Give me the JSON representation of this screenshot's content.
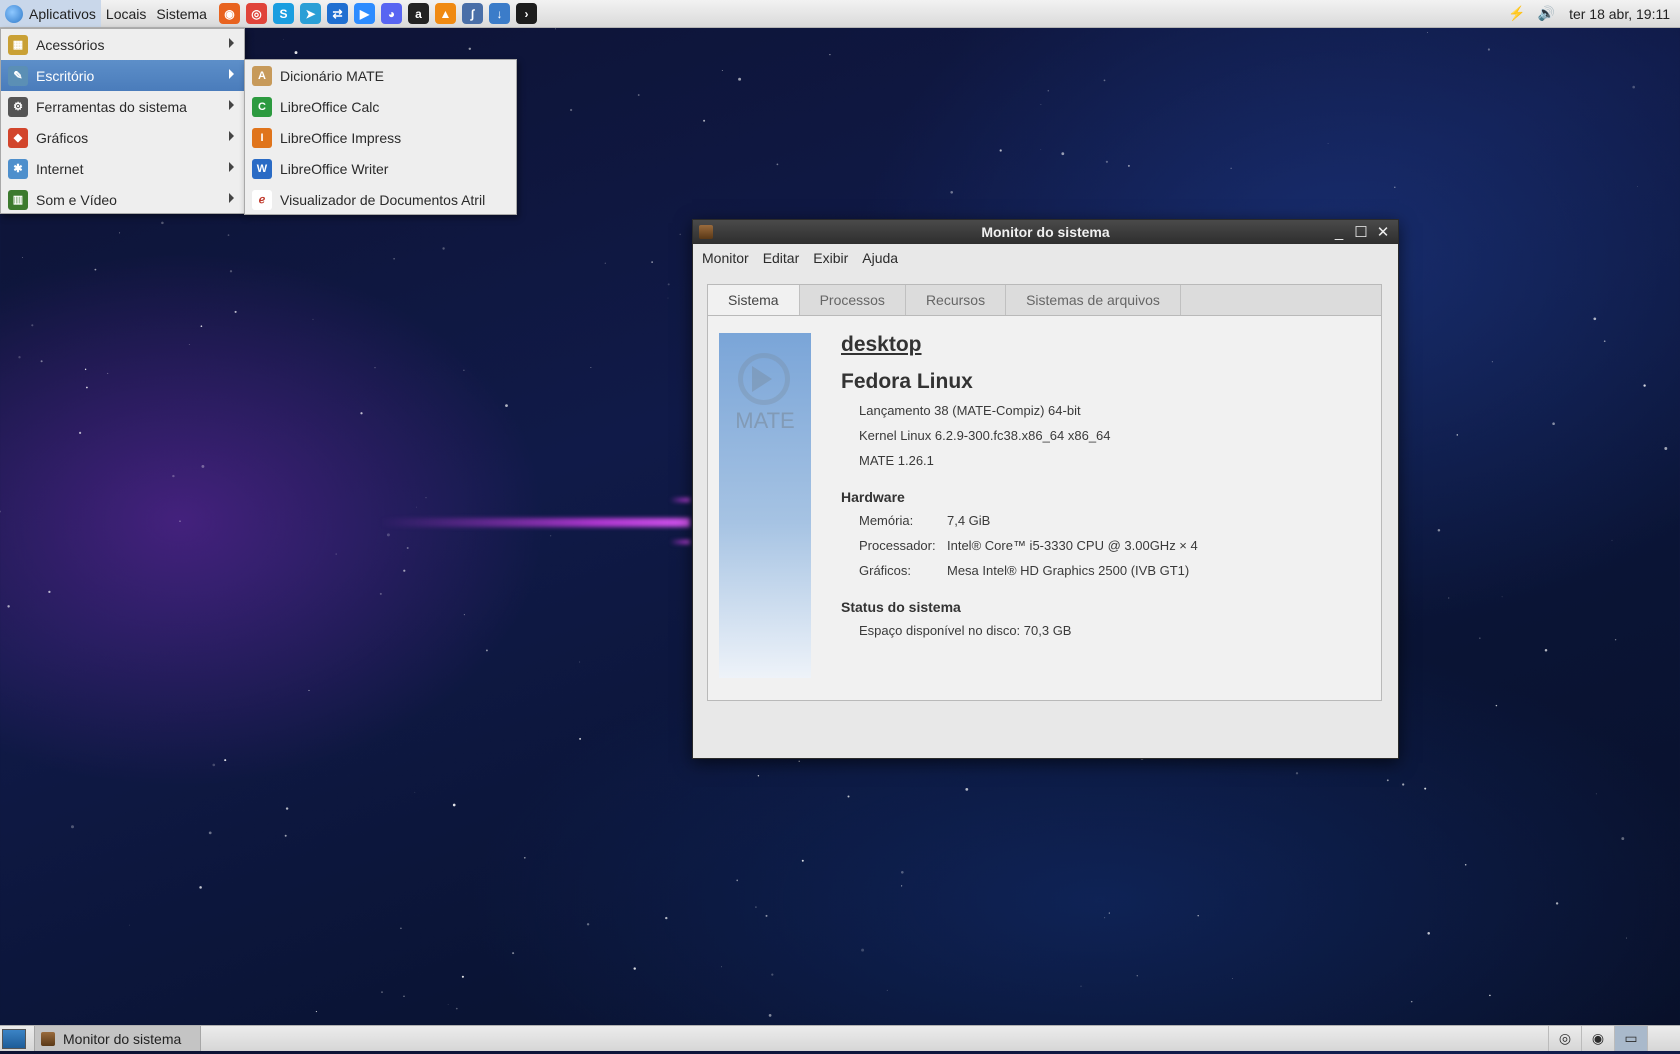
{
  "top_panel": {
    "menus": [
      {
        "label": "Aplicativos"
      },
      {
        "label": "Locais"
      },
      {
        "label": "Sistema"
      }
    ],
    "launchers": [
      {
        "icon": "firefox-icon",
        "color": "#e8631f",
        "glyph": "◉"
      },
      {
        "icon": "chrome-icon",
        "color": "#e0443a",
        "glyph": "◎"
      },
      {
        "icon": "skype-icon",
        "color": "#1a9ee0",
        "glyph": "S"
      },
      {
        "icon": "telegram-icon",
        "color": "#2a9fd6",
        "glyph": "➤"
      },
      {
        "icon": "teamviewer-icon",
        "color": "#1f6fd1",
        "glyph": "⇄"
      },
      {
        "icon": "zoom-icon",
        "color": "#2d8cff",
        "glyph": "▶"
      },
      {
        "icon": "discord-icon",
        "color": "#5865f2",
        "glyph": "◕"
      },
      {
        "icon": "amazon-icon",
        "color": "#222222",
        "glyph": "a"
      },
      {
        "icon": "vlc-icon",
        "color": "#f08a12",
        "glyph": "▲"
      },
      {
        "icon": "ebook-icon",
        "color": "#4a6fa8",
        "glyph": "∫"
      },
      {
        "icon": "download-icon",
        "color": "#3b7cc9",
        "glyph": "↓"
      },
      {
        "icon": "terminal-icon",
        "color": "#1c1c1c",
        "glyph": "›"
      }
    ],
    "tray": [
      {
        "icon": "network-icon",
        "glyph": "⚡"
      },
      {
        "icon": "volume-icon",
        "glyph": "🔊"
      }
    ],
    "clock": "ter 18 abr, 19:11"
  },
  "apps_menu": [
    {
      "label": "Acessórios",
      "icon": "accessories-icon",
      "color": "#c9a035",
      "glyph": "▦"
    },
    {
      "label": "Escritório",
      "icon": "office-icon",
      "color": "#5b8fb5",
      "glyph": "✎",
      "selected": true
    },
    {
      "label": "Ferramentas do sistema",
      "icon": "system-tools-icon",
      "color": "#555555",
      "glyph": "⚙"
    },
    {
      "label": "Gráficos",
      "icon": "graphics-icon",
      "color": "#d2452c",
      "glyph": "◆"
    },
    {
      "label": "Internet",
      "icon": "internet-icon",
      "color": "#4e8fcc",
      "glyph": "✱"
    },
    {
      "label": "Som e Vídeo",
      "icon": "sound-video-icon",
      "color": "#3c7a2e",
      "glyph": "▥"
    }
  ],
  "office_menu": [
    {
      "label": "Dicionário MATE",
      "icon": "dictionary-icon",
      "color": "#c79a5a",
      "glyph": "A"
    },
    {
      "label": "LibreOffice Calc",
      "icon": "libreoffice-calc-icon",
      "color": "#2c9a3f",
      "glyph": "C"
    },
    {
      "label": "LibreOffice Impress",
      "icon": "libreoffice-impress-icon",
      "color": "#e0741b",
      "glyph": "I"
    },
    {
      "label": "LibreOffice Writer",
      "icon": "libreoffice-writer-icon",
      "color": "#2a6bc5",
      "glyph": "W"
    },
    {
      "label": "Visualizador de Documentos Atril",
      "icon": "atril-icon",
      "color": "#ffffff",
      "glyph": "ℯ"
    }
  ],
  "window": {
    "title": "Monitor do sistema",
    "menubar": [
      "Monitor",
      "Editar",
      "Exibir",
      "Ajuda"
    ],
    "tabs": [
      "Sistema",
      "Processos",
      "Recursos",
      "Sistemas de arquivos"
    ],
    "logo_text": "MATE",
    "hostname": "desktop",
    "distro": "Fedora Linux",
    "release": "Lançamento 38 (MATE-Compiz) 64-bit",
    "kernel": "Kernel Linux 6.2.9-300.fc38.x86_64 x86_64",
    "mate_version": "MATE 1.26.1",
    "hardware_heading": "Hardware",
    "memory_label": "Memória:",
    "memory_value": "7,4 GiB",
    "cpu_label": "Processador:",
    "cpu_value": "Intel® Core™ i5-3330 CPU @ 3.00GHz × 4",
    "gpu_label": "Gráficos:",
    "gpu_value": "Mesa Intel® HD Graphics 2500 (IVB GT1)",
    "status_heading": "Status do sistema",
    "disk_label": "Espaço disponível no disco:",
    "disk_value": "70,3 GB"
  },
  "bottom_panel": {
    "task_label": "Monitor do sistema"
  },
  "colors": {
    "menu_selected": "#4a7cbb",
    "panel": "#e4e4e4",
    "titlebar": "#353535"
  }
}
